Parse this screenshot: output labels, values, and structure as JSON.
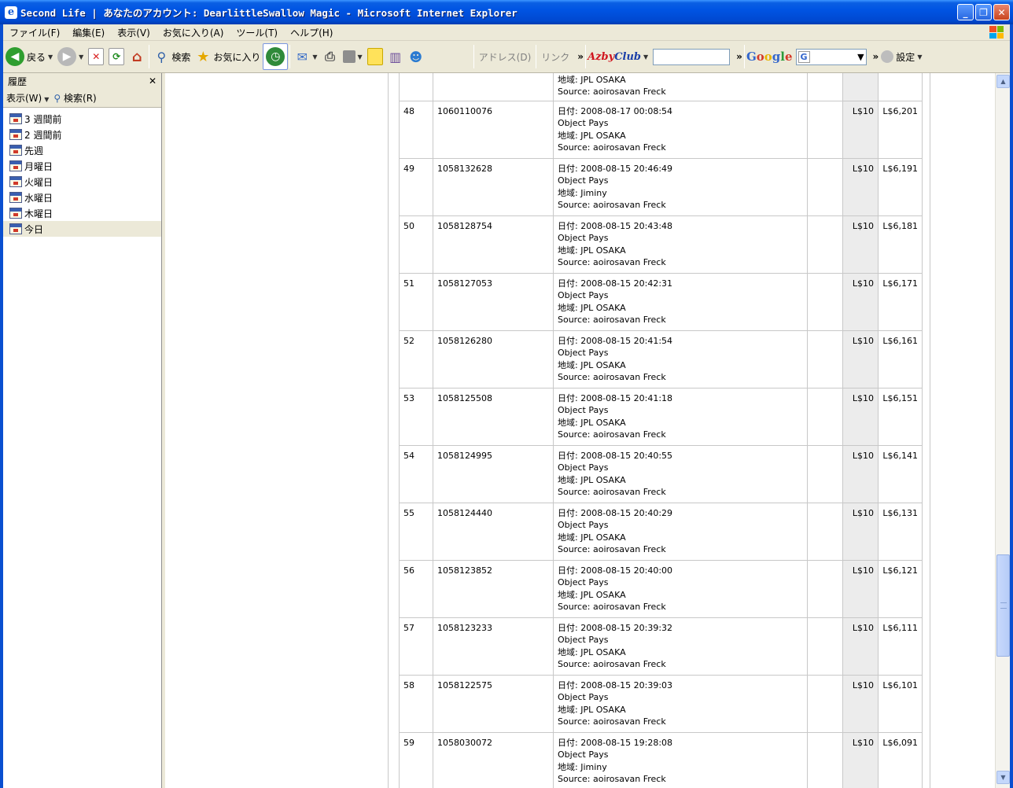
{
  "window": {
    "title": "Second Life | あなたのアカウント: DearlittleSwallow Magic - Microsoft Internet Explorer",
    "minimize": "_",
    "maximize": "❐",
    "close": "✕"
  },
  "menu": [
    "ファイル(F)",
    "編集(E)",
    "表示(V)",
    "お気に入り(A)",
    "ツール(T)",
    "ヘルプ(H)"
  ],
  "toolbar": {
    "back": "戻る",
    "search": "検索",
    "favorites": "お気に入り",
    "address": "アドレス(D)",
    "links": "リンク",
    "azby_a": "Azby",
    "azby_b": "Club",
    "google": "Google",
    "google_select": "G",
    "settings": "設定",
    "more": "»"
  },
  "sidebar": {
    "title": "履歴",
    "close": "✕",
    "view": "表示(W)",
    "search": "検索(R)",
    "items": [
      "3 週間前",
      "2 週間前",
      "先週",
      "月曜日",
      "火曜日",
      "水曜日",
      "木曜日",
      "今日"
    ]
  },
  "transactions": [
    {
      "num": "",
      "id": "",
      "date": "",
      "type": "",
      "region": "地域: JPL OSAKA",
      "source": "Source: aoirosavan Freck",
      "amount": "",
      "balance": ""
    },
    {
      "num": "48",
      "id": "1060110076",
      "date": "日付: 2008-08-17 00:08:54",
      "type": "Object Pays",
      "region": "地域: JPL OSAKA",
      "source": "Source: aoirosavan Freck",
      "amount": "L$10",
      "balance": "L$6,201"
    },
    {
      "num": "49",
      "id": "1058132628",
      "date": "日付: 2008-08-15 20:46:49",
      "type": "Object Pays",
      "region": "地域: Jiminy",
      "source": "Source: aoirosavan Freck",
      "amount": "L$10",
      "balance": "L$6,191"
    },
    {
      "num": "50",
      "id": "1058128754",
      "date": "日付: 2008-08-15 20:43:48",
      "type": "Object Pays",
      "region": "地域: JPL OSAKA",
      "source": "Source: aoirosavan Freck",
      "amount": "L$10",
      "balance": "L$6,181"
    },
    {
      "num": "51",
      "id": "1058127053",
      "date": "日付: 2008-08-15 20:42:31",
      "type": "Object Pays",
      "region": "地域: JPL OSAKA",
      "source": "Source: aoirosavan Freck",
      "amount": "L$10",
      "balance": "L$6,171"
    },
    {
      "num": "52",
      "id": "1058126280",
      "date": "日付: 2008-08-15 20:41:54",
      "type": "Object Pays",
      "region": "地域: JPL OSAKA",
      "source": "Source: aoirosavan Freck",
      "amount": "L$10",
      "balance": "L$6,161"
    },
    {
      "num": "53",
      "id": "1058125508",
      "date": "日付: 2008-08-15 20:41:18",
      "type": "Object Pays",
      "region": "地域: JPL OSAKA",
      "source": "Source: aoirosavan Freck",
      "amount": "L$10",
      "balance": "L$6,151"
    },
    {
      "num": "54",
      "id": "1058124995",
      "date": "日付: 2008-08-15 20:40:55",
      "type": "Object Pays",
      "region": "地域: JPL OSAKA",
      "source": "Source: aoirosavan Freck",
      "amount": "L$10",
      "balance": "L$6,141"
    },
    {
      "num": "55",
      "id": "1058124440",
      "date": "日付: 2008-08-15 20:40:29",
      "type": "Object Pays",
      "region": "地域: JPL OSAKA",
      "source": "Source: aoirosavan Freck",
      "amount": "L$10",
      "balance": "L$6,131"
    },
    {
      "num": "56",
      "id": "1058123852",
      "date": "日付: 2008-08-15 20:40:00",
      "type": "Object Pays",
      "region": "地域: JPL OSAKA",
      "source": "Source: aoirosavan Freck",
      "amount": "L$10",
      "balance": "L$6,121"
    },
    {
      "num": "57",
      "id": "1058123233",
      "date": "日付: 2008-08-15 20:39:32",
      "type": "Object Pays",
      "region": "地域: JPL OSAKA",
      "source": "Source: aoirosavan Freck",
      "amount": "L$10",
      "balance": "L$6,111"
    },
    {
      "num": "58",
      "id": "1058122575",
      "date": "日付: 2008-08-15 20:39:03",
      "type": "Object Pays",
      "region": "地域: JPL OSAKA",
      "source": "Source: aoirosavan Freck",
      "amount": "L$10",
      "balance": "L$6,101"
    },
    {
      "num": "59",
      "id": "1058030072",
      "date": "日付: 2008-08-15 19:28:08",
      "type": "Object Pays",
      "region": "地域: Jiminy",
      "source": "Source: aoirosavan Freck",
      "amount": "L$10",
      "balance": "L$6,091"
    }
  ],
  "colors": {
    "titlebar": "#0054e3",
    "chrome": "#ece9d8",
    "amount_col": "#ececec",
    "cursor": "#e8141e"
  }
}
